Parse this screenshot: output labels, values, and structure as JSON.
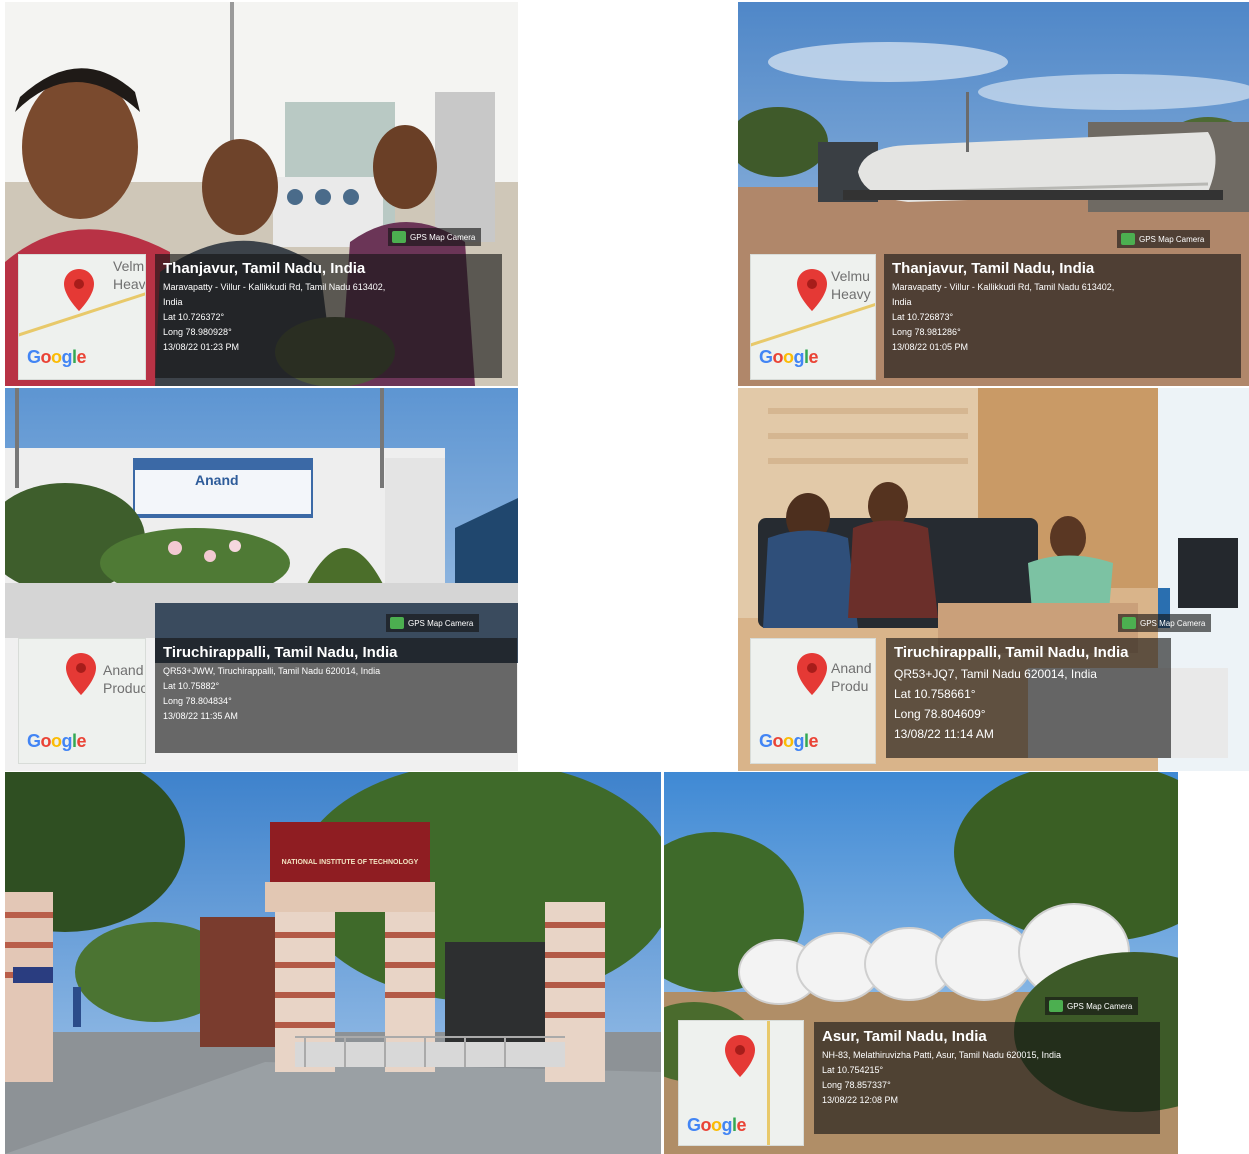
{
  "photos": [
    {
      "id": "p1",
      "map_place": "Velm\nHeav",
      "badge": "GPS Map Camera",
      "city": "Thanjavur, Tamil Nadu, India",
      "address": "Maravapatty - Villur - Kallikkudi Rd, Tamil Nadu 613402,",
      "address2": "India",
      "lat": "Lat 10.726372°",
      "long": "Long 78.980928°",
      "datetime": "13/08/22 01:23 PM"
    },
    {
      "id": "p2",
      "map_place": "Velmu\nHeavy",
      "badge": "GPS Map Camera",
      "city": "Thanjavur, Tamil Nadu, India",
      "address": "Maravapatty - Villur - Kallikkudi Rd, Tamil Nadu 613402,",
      "address2": "India",
      "lat": "Lat 10.726873°",
      "long": "Long 78.981286°",
      "datetime": "13/08/22 01:05 PM"
    },
    {
      "id": "p3",
      "map_place": "Anand\nProduc",
      "badge": "GPS Map Camera",
      "sign": "Anand",
      "city": "Tiruchirappalli, Tamil Nadu, India",
      "address": "QR53+JWW, Tiruchirappalli, Tamil Nadu 620014, India",
      "lat": "Lat 10.75882°",
      "long": "Long 78.804834°",
      "datetime": "13/08/22 11:35 AM"
    },
    {
      "id": "p4",
      "map_place": "Anand\nProdu",
      "badge": "GPS Map Camera",
      "city": "Tiruchirappalli, Tamil Nadu, India",
      "address": "QR53+JQ7, Tamil Nadu 620014, India",
      "lat": "Lat 10.758661°",
      "long": "Long 78.804609°",
      "datetime": "13/08/22 11:14 AM"
    },
    {
      "id": "p6",
      "map_place": "",
      "badge": "GPS Map Camera",
      "city": "Asur, Tamil Nadu, India",
      "address": "NH-83, Melathiruvizha Patti, Asur, Tamil Nadu 620015, India",
      "lat": "Lat 10.754215°",
      "long": "Long 78.857337°",
      "datetime": "13/08/22 12:08 PM"
    }
  ],
  "map_logo": "Google",
  "gate_sign": "NATIONAL INSTITUTE OF TECHNOLOGY",
  "colors": {
    "pin": "#e53935",
    "overlay": "#141414",
    "badge_icon": "#4caf50"
  }
}
